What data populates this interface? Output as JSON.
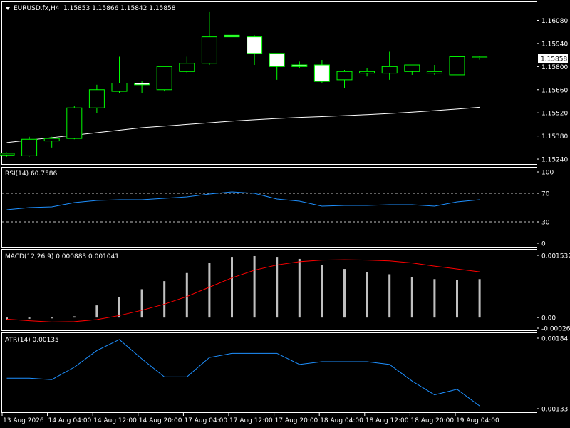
{
  "colors": {
    "background": "#000000",
    "foreground": "#ffffff",
    "grid": "#c0c0c0",
    "bull_border": "#00ff00",
    "bull_fill": "#000000",
    "bear_fill": "#ffffff",
    "ma": "#ffffff",
    "rsi": "#1e90ff",
    "macd_hist": "#c0c0c0",
    "macd_signal": "#ff0000",
    "atr": "#1e90ff"
  },
  "chart_data": [
    {
      "type": "candlestick",
      "symbol_label": "EURUSD.fx,H4",
      "ohlc_label": "1.15853 1.15866 1.15842 1.15858",
      "current_price_label": "1.15858",
      "y_ticks": [
        "1.16080",
        "1.15940",
        "1.15800",
        "1.15660",
        "1.15520",
        "1.15380",
        "1.15240"
      ],
      "ylim": [
        1.1521,
        1.1619
      ],
      "candles": [
        {
          "o": 1.15265,
          "h": 1.1528,
          "l": 1.15255,
          "c": 1.15275
        },
        {
          "o": 1.1526,
          "h": 1.15375,
          "l": 1.15255,
          "c": 1.1536
        },
        {
          "o": 1.1535,
          "h": 1.15375,
          "l": 1.1531,
          "c": 1.15365
        },
        {
          "o": 1.15365,
          "h": 1.1556,
          "l": 1.1536,
          "c": 1.1555
        },
        {
          "o": 1.1555,
          "h": 1.1569,
          "l": 1.1552,
          "c": 1.1566
        },
        {
          "o": 1.1565,
          "h": 1.1586,
          "l": 1.1564,
          "c": 1.157
        },
        {
          "o": 1.157,
          "h": 1.1571,
          "l": 1.1564,
          "c": 1.1569
        },
        {
          "o": 1.1566,
          "h": 1.1577,
          "l": 1.1565,
          "c": 1.158
        },
        {
          "o": 1.1577,
          "h": 1.1586,
          "l": 1.1576,
          "c": 1.1582
        },
        {
          "o": 1.1582,
          "h": 1.1613,
          "l": 1.1581,
          "c": 1.1598
        },
        {
          "o": 1.1599,
          "h": 1.1602,
          "l": 1.1586,
          "c": 1.1598
        },
        {
          "o": 1.1598,
          "h": 1.1599,
          "l": 1.1581,
          "c": 1.1588
        },
        {
          "o": 1.1588,
          "h": 1.1587,
          "l": 1.1572,
          "c": 1.158
        },
        {
          "o": 1.1581,
          "h": 1.1583,
          "l": 1.1579,
          "c": 1.158
        },
        {
          "o": 1.1581,
          "h": 1.1584,
          "l": 1.157,
          "c": 1.1571
        },
        {
          "o": 1.1572,
          "h": 1.1578,
          "l": 1.1567,
          "c": 1.1577
        },
        {
          "o": 1.1576,
          "h": 1.1579,
          "l": 1.1574,
          "c": 1.1577
        },
        {
          "o": 1.1576,
          "h": 1.1589,
          "l": 1.1572,
          "c": 1.158
        },
        {
          "o": 1.1577,
          "h": 1.1581,
          "l": 1.1575,
          "c": 1.1581
        },
        {
          "o": 1.1576,
          "h": 1.1581,
          "l": 1.1575,
          "c": 1.1577
        },
        {
          "o": 1.1575,
          "h": 1.1587,
          "l": 1.1571,
          "c": 1.1586
        },
        {
          "o": 1.15853,
          "h": 1.15866,
          "l": 1.15842,
          "c": 1.15858
        }
      ],
      "ma_values": [
        1.1534,
        1.15355,
        1.1537,
        1.15385,
        1.154,
        1.15415,
        1.1543,
        1.1544,
        1.1545,
        1.1546,
        1.1547,
        1.15478,
        1.15486,
        1.15492,
        1.15497,
        1.15503,
        1.15509,
        1.15516,
        1.15524,
        1.15533,
        1.15543,
        1.15554
      ]
    },
    {
      "type": "line",
      "label": "RSI(14) 60.7586",
      "y_ticks": [
        "100",
        "70",
        "30",
        "0"
      ],
      "levels": [
        70,
        30
      ],
      "ylim": [
        0,
        100
      ],
      "values": [
        47,
        50,
        51,
        57,
        60,
        61,
        61,
        63,
        65,
        69,
        72,
        70,
        62,
        59,
        52,
        53,
        53,
        54,
        54,
        52,
        58,
        61
      ]
    },
    {
      "type": "bar+line",
      "label": "MACD(12,26,9) 0.000883 0.001041",
      "y_ticks": [
        "0.001537",
        "0.00",
        "-0.000262"
      ],
      "ylim": [
        -0.000262,
        0.001537
      ],
      "histogram": [
        -6e-05,
        -3e-05,
        -2e-05,
        3e-05,
        0.0003,
        0.0005,
        0.0007,
        0.0009,
        0.0011,
        0.00135,
        0.0015,
        0.00152,
        0.0015,
        0.00145,
        0.0013,
        0.0012,
        0.00113,
        0.00107,
        0.001,
        0.00095,
        0.00093,
        0.00095
      ],
      "signal": [
        -4e-05,
        -8e-05,
        -0.00011,
        -0.0001,
        -5e-05,
        5e-05,
        0.00018,
        0.00033,
        0.00052,
        0.00075,
        0.00098,
        0.00117,
        0.0013,
        0.00138,
        0.00142,
        0.00143,
        0.00142,
        0.0014,
        0.00135,
        0.00127,
        0.0012,
        0.00113
      ]
    },
    {
      "type": "line",
      "label": "ATR(14) 0.00135",
      "y_ticks": [
        "0.00184",
        "0.00133"
      ],
      "ylim": [
        0.00133,
        0.00184
      ],
      "values": [
        0.00155,
        0.00155,
        0.00154,
        0.00163,
        0.00175,
        0.00183,
        0.00169,
        0.00156,
        0.00156,
        0.0017,
        0.00173,
        0.00173,
        0.00173,
        0.00165,
        0.00167,
        0.00167,
        0.00167,
        0.00165,
        0.00153,
        0.00143,
        0.00147,
        0.00135
      ]
    }
  ],
  "time_axis": {
    "labels": [
      "13 Aug 2026",
      "14 Aug 04:00",
      "14 Aug 12:00",
      "14 Aug 20:00",
      "17 Aug 04:00",
      "17 Aug 12:00",
      "17 Aug 20:00",
      "18 Aug 04:00",
      "18 Aug 12:00",
      "18 Aug 20:00",
      "19 Aug 04:00"
    ]
  }
}
